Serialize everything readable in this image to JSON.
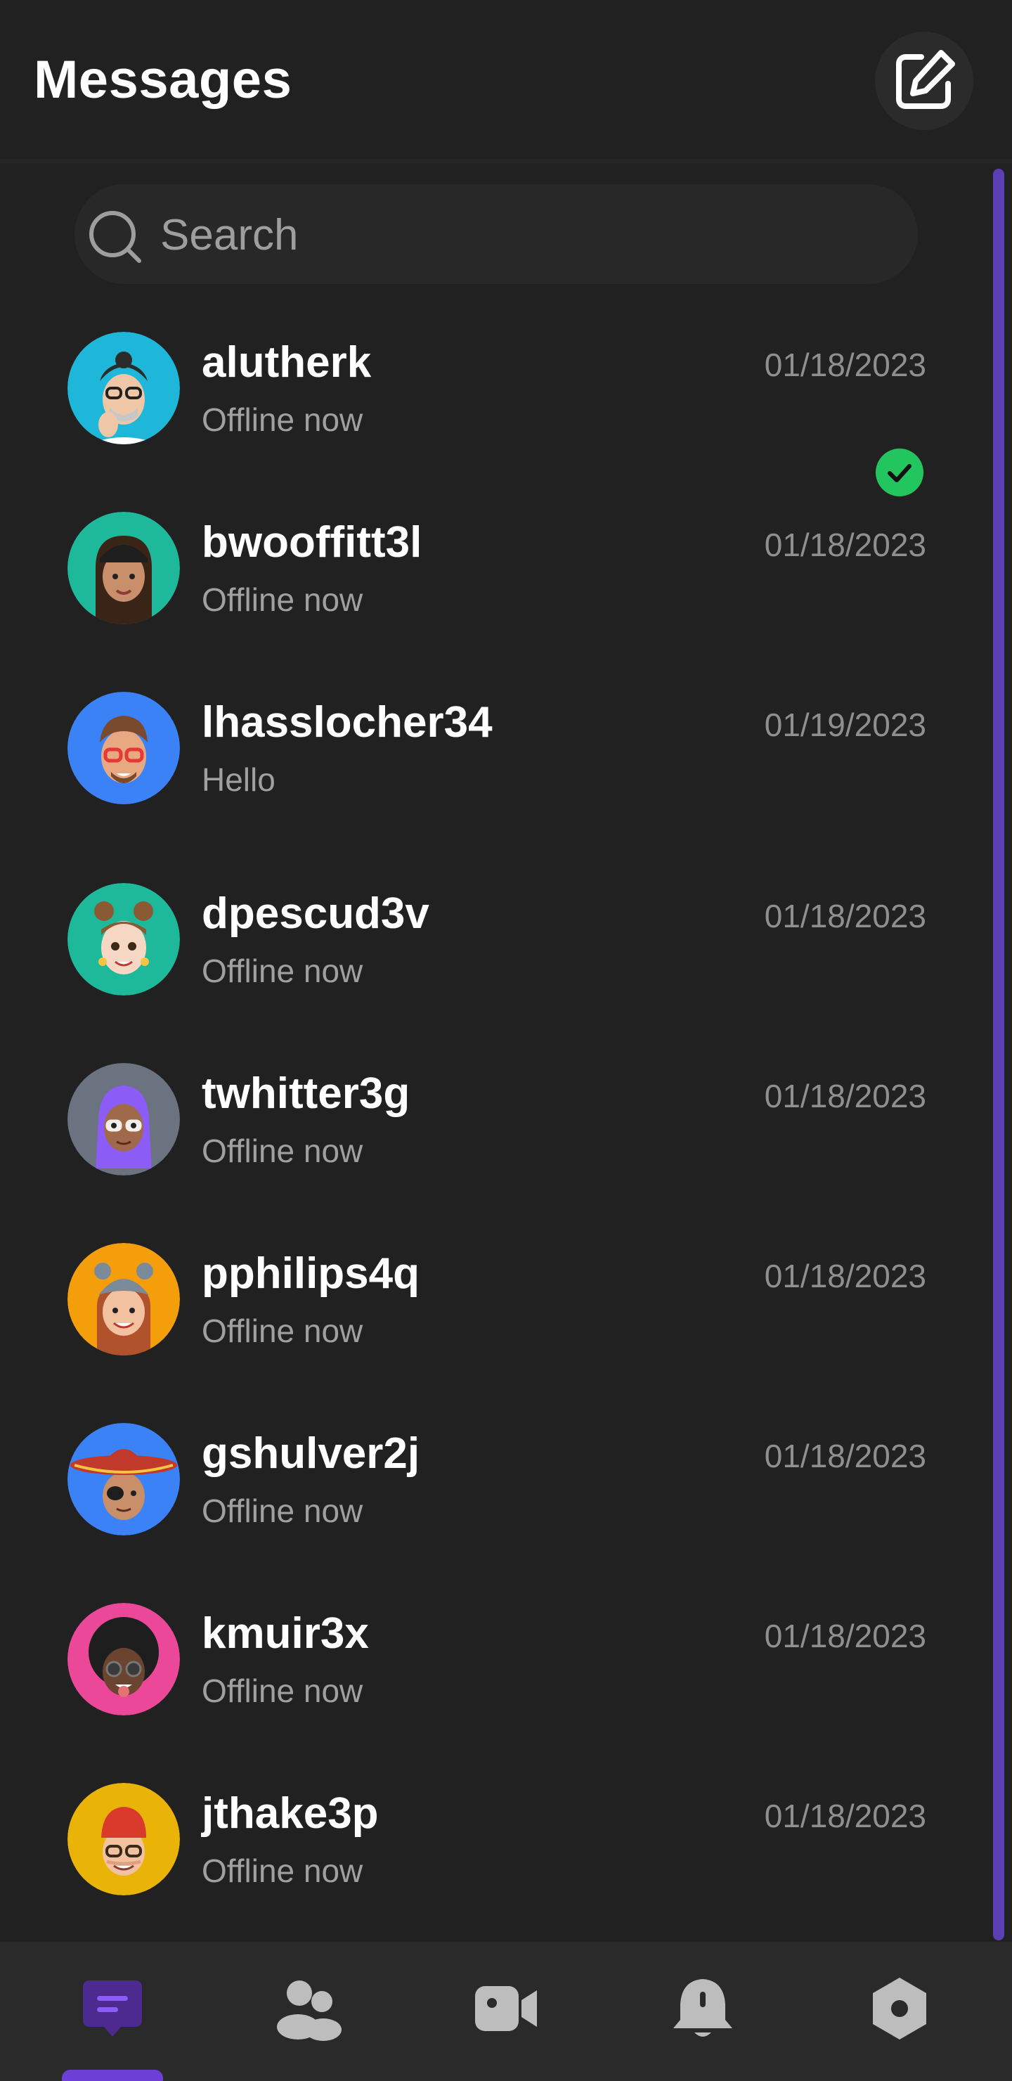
{
  "header": {
    "title": "Messages",
    "compose_icon": "compose-icon"
  },
  "search": {
    "placeholder": "Search",
    "value": ""
  },
  "conversations": [
    {
      "username": "alutherk",
      "preview": "Offline now",
      "date": "01/18/2023",
      "avatar_color": "#1fb7d9"
    },
    {
      "username": "bwooffitt3l",
      "preview": "Offline now",
      "date": "01/18/2023",
      "avatar_color": "#1db99a"
    },
    {
      "username": "lhasslocher34",
      "preview": "Hello",
      "date": "01/19/2023",
      "avatar_color": "#3b82f6",
      "read_status": "read-check-icon"
    },
    {
      "username": "dpescud3v",
      "preview": "Offline now",
      "date": "01/18/2023",
      "avatar_color": "#1db99a"
    },
    {
      "username": "twhitter3g",
      "preview": "Offline now",
      "date": "01/18/2023",
      "avatar_color": "#6b7280"
    },
    {
      "username": "pphilips4q",
      "preview": "Offline now",
      "date": "01/18/2023",
      "avatar_color": "#f59e0b"
    },
    {
      "username": "gshulver2j",
      "preview": "Offline now",
      "date": "01/18/2023",
      "avatar_color": "#3b82f6"
    },
    {
      "username": "kmuir3x",
      "preview": "Offline now",
      "date": "01/18/2023",
      "avatar_color": "#ec4899"
    },
    {
      "username": "jthake3p",
      "preview": "Offline now",
      "date": "01/18/2023",
      "avatar_color": "#eab308"
    }
  ],
  "bottom_nav": {
    "items": [
      {
        "icon": "chat-icon",
        "active": true
      },
      {
        "icon": "contacts-icon",
        "active": false
      },
      {
        "icon": "video-call-icon",
        "active": false
      },
      {
        "icon": "notifications-icon",
        "active": false
      },
      {
        "icon": "settings-icon",
        "active": false
      }
    ]
  },
  "colors": {
    "background": "#212121",
    "accent": "#6d3fd6",
    "read_badge": "#22c55e",
    "muted_text": "#a0a0a0"
  }
}
